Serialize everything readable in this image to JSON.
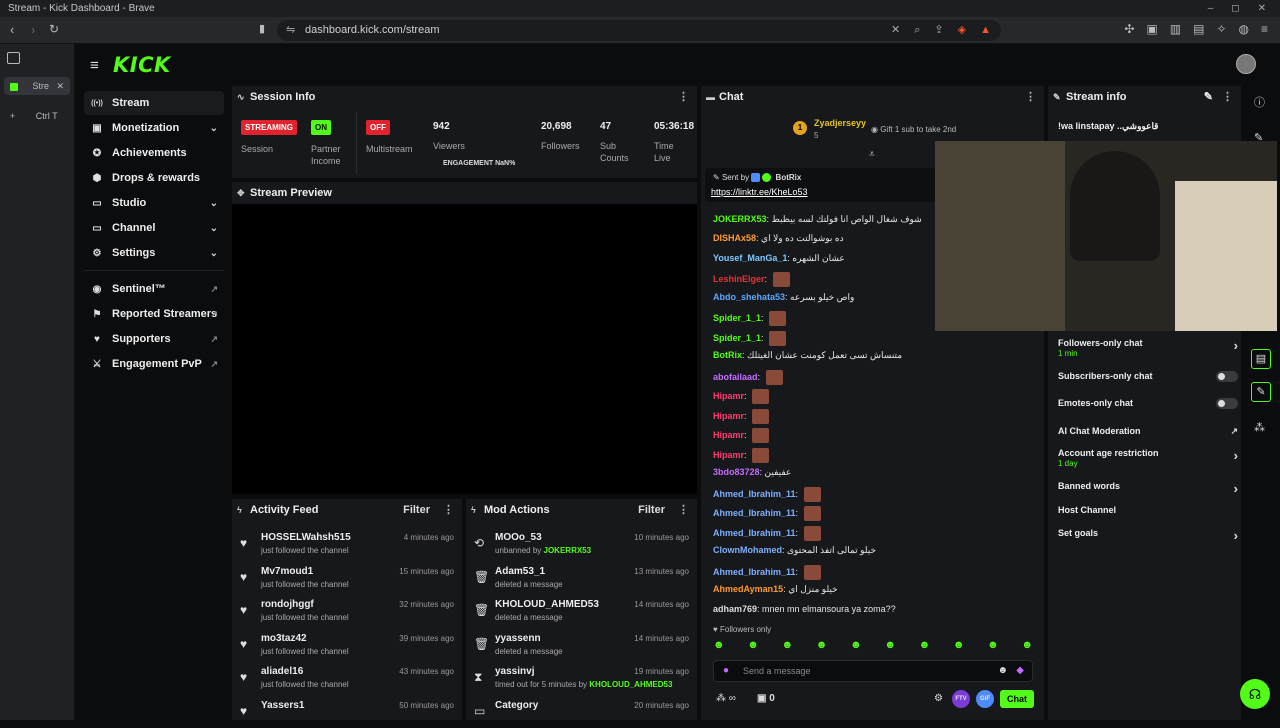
{
  "window": {
    "title": "Stream - Kick Dashboard - Brave",
    "controls": [
      "–",
      "◻",
      "✕"
    ]
  },
  "browser": {
    "url": "dashboard.kick.com/stream",
    "tab_label": "Stre",
    "new_tab_hint": "Ctrl T"
  },
  "sidebar": {
    "logo": "KICK",
    "items": [
      {
        "label": "Stream",
        "icon": "((•))"
      },
      {
        "label": "Monetization",
        "icon": "▣"
      },
      {
        "label": "Achievements",
        "icon": "✪"
      },
      {
        "label": "Drops & rewards",
        "icon": "⬢"
      },
      {
        "label": "Studio",
        "icon": "▭"
      },
      {
        "label": "Channel",
        "icon": "▭"
      },
      {
        "label": "Settings",
        "icon": "⚙"
      },
      {
        "label": "Sentinel™",
        "icon": "◉"
      },
      {
        "label": "Reported Streamers",
        "icon": "⚑"
      },
      {
        "label": "Supporters",
        "icon": "♥"
      },
      {
        "label": "Engagement PvP",
        "icon": "⚔"
      }
    ]
  },
  "session": {
    "title": "Session Info",
    "streaming_badge": "STREAMING",
    "session_label": "Session",
    "partner_badge": "ON",
    "partner_label": "Partner Income",
    "multi_badge": "OFF",
    "multi_label": "Multistream",
    "viewers_value": "942",
    "viewers_label": "Viewers",
    "engagement": "ENGAGEMENT NaN%",
    "followers_value": "20,698",
    "followers_label": "Followers",
    "subs_value": "47",
    "subs_label": "Sub Counts",
    "time_value": "05:36:18",
    "time_label": "Time Live"
  },
  "preview": {
    "title": "Stream Preview"
  },
  "activity": {
    "title": "Activity Feed",
    "filter": "Filter",
    "rows": [
      {
        "name": "HOSSELWahsh515",
        "sub": "just followed the channel",
        "time": "4 minutes ago"
      },
      {
        "name": "Mv7moud1",
        "sub": "just followed the channel",
        "time": "15 minutes ago"
      },
      {
        "name": "rondojhggf",
        "sub": "just followed the channel",
        "time": "32 minutes ago"
      },
      {
        "name": "mo3taz42",
        "sub": "just followed the channel",
        "time": "39 minutes ago"
      },
      {
        "name": "aliadel16",
        "sub": "just followed the channel",
        "time": "43 minutes ago"
      },
      {
        "name": "Yassers1",
        "sub": "",
        "time": "50 minutes ago"
      }
    ]
  },
  "mod": {
    "title": "Mod Actions",
    "filter": "Filter",
    "rows": [
      {
        "name": "MOOo_53",
        "sub": "unbanned by",
        "by": "JOKERRX53",
        "time": "10 minutes ago",
        "icon": "⟲"
      },
      {
        "name": "Adam53_1",
        "sub": "deleted a message",
        "by": "",
        "time": "13 minutes ago",
        "icon": "🗑"
      },
      {
        "name": "KHOLOUD_AHMED53",
        "sub": "deleted a message",
        "by": "",
        "time": "14 minutes ago",
        "icon": "🗑"
      },
      {
        "name": "yyassenn",
        "sub": "deleted a message",
        "by": "",
        "time": "14 minutes ago",
        "icon": "🗑"
      },
      {
        "name": "yassinvj",
        "sub": "timed out for 5 minutes by",
        "by": "KHOLOUD_AHMED53",
        "time": "19 minutes ago",
        "icon": "⧗"
      },
      {
        "name": "Category",
        "sub": "",
        "by": "",
        "time": "20 minutes ago",
        "icon": "▭"
      }
    ]
  },
  "chat": {
    "title": "Chat",
    "gifter": "Zyadjerseyy",
    "gifter_count": "5",
    "gift_text": "Gift 1 sub to take 2nd",
    "pinned_sender_prefix": "Sent by",
    "pinned_sender": "BotRix",
    "pinned_link": "https://linktr.ee/KheLo53",
    "messages": [
      {
        "user": "JOKERRX53",
        "color": "#53fc18",
        "text": "شوف شغال الواص انا فولتك لسه بيظبط"
      },
      {
        "user": "DISHAx58",
        "color": "#ff9a2e",
        "text": "ده بوشوالتت ده ولا اي"
      },
      {
        "user": "Yousef_ManGa_1",
        "color": "#7dc8ff",
        "text": "عشان الشهره"
      },
      {
        "user": "LeshinElger",
        "color": "#e03636",
        "text": ""
      },
      {
        "user": "Abdo_shehata53",
        "color": "#5aa8ff",
        "text": "واص خيلو بسرعه"
      },
      {
        "user": "Spider_1_1",
        "color": "#53fc18",
        "text": ""
      },
      {
        "user": "Spider_1_1",
        "color": "#53fc18",
        "text": ""
      },
      {
        "user": "BotRix",
        "color": "#53fc18",
        "text": "متنساش تسى تعمل كومنت عشان الغيتلك"
      },
      {
        "user": "abofailaad",
        "color": "#c46cff",
        "text": ""
      },
      {
        "user": "Hipamr",
        "color": "#ff3b6b",
        "text": ""
      },
      {
        "user": "Hipamr",
        "color": "#ff3b6b",
        "text": ""
      },
      {
        "user": "Hipamr",
        "color": "#ff3b6b",
        "text": ""
      },
      {
        "user": "Hipamr",
        "color": "#ff3b6b",
        "text": ""
      },
      {
        "user": "3bdo83728",
        "color": "#c46cff",
        "text": "عفيفين"
      },
      {
        "user": "Ahmed_Ibrahim_11",
        "color": "#7db0ff",
        "text": ""
      },
      {
        "user": "Ahmed_Ibrahim_11",
        "color": "#7db0ff",
        "text": ""
      },
      {
        "user": "Ahmed_Ibrahim_11",
        "color": "#7db0ff",
        "text": ""
      },
      {
        "user": "ClownMohamed",
        "color": "#7db0ff",
        "text": "خيلو تمالى اتفذ المحتوى"
      },
      {
        "user": "Ahmed_Ibrahim_11",
        "color": "#7db0ff",
        "text": ""
      },
      {
        "user": "AhmedAyman15",
        "color": "#ff9a2e",
        "text": "خيلو منزل اي"
      },
      {
        "user": "adham769",
        "color": "#dddddd",
        "text": "mnen mn elmansoura ya zoma??"
      }
    ],
    "followers_only": "Followers only",
    "input_placeholder": "Send a message",
    "infinity": "∞",
    "zero": "0",
    "chat_button": "Chat",
    "ftv": "FTV",
    "gif": "GIF"
  },
  "streaminfo": {
    "title": "Stream info",
    "title_text": "!wa linstapay ..قاعووشي",
    "rows": [
      {
        "label": "Followers-only chat",
        "sub": "1 min",
        "ctl": "chevron"
      },
      {
        "label": "Subscribers-only chat",
        "sub": "",
        "ctl": "toggle"
      },
      {
        "label": "Emotes-only chat",
        "sub": "",
        "ctl": "toggle"
      },
      {
        "label": "AI Chat Moderation",
        "sub": "",
        "ctl": "ext"
      },
      {
        "label": "Account age restriction",
        "sub": "1 day",
        "ctl": "chevron"
      },
      {
        "label": "Banned words",
        "sub": "",
        "ctl": "chevron"
      },
      {
        "label": "Host Channel",
        "sub": "",
        "ctl": "none"
      },
      {
        "label": "Set goals",
        "sub": "",
        "ctl": "chevron"
      }
    ]
  },
  "colors": {
    "accent": "#53fc18",
    "live_red": "#e0232e"
  }
}
